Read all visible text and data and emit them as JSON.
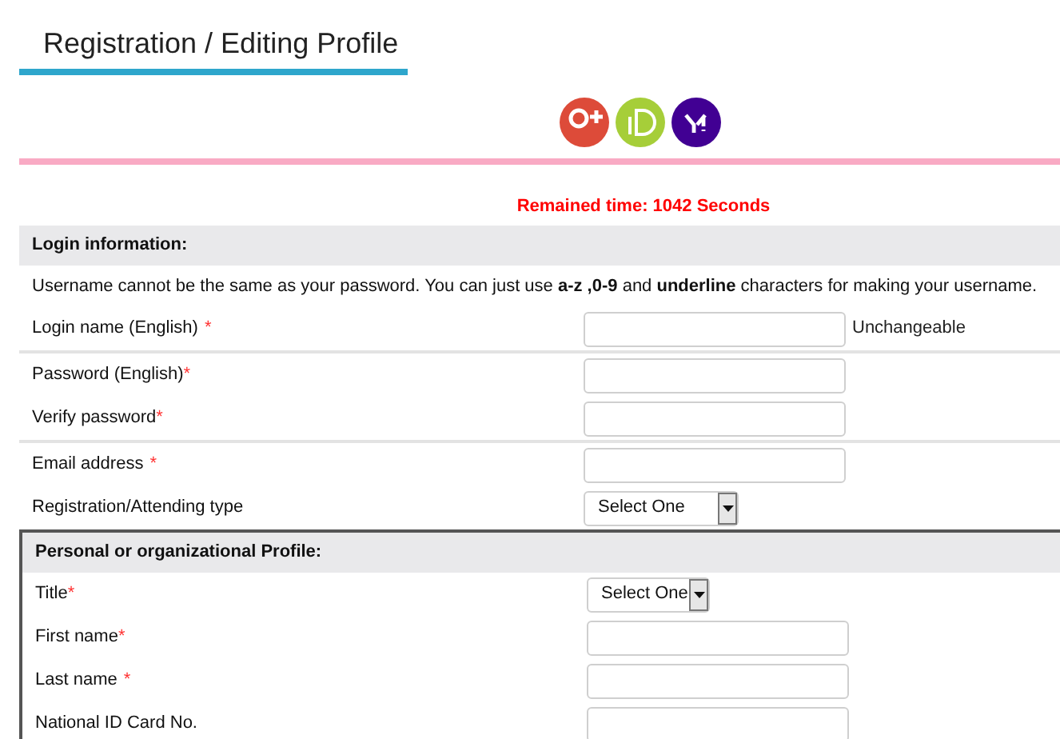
{
  "page_title": "Registration / Editing Profile",
  "timer": "Remained time: 1042 Seconds",
  "sections": [
    {
      "heading": "Login information:",
      "note": "Username cannot be the same as your password. You can just use **a-z ,0-9** and **underline** characters for making your username.",
      "top_border": false,
      "groups": [
        [
          {
            "label": "Login name (English)",
            "mark": "*",
            "spaced": true,
            "kind": "input",
            "hint": "Unchangeable"
          }
        ],
        [
          {
            "label": "Password (English)",
            "mark": "*",
            "spaced": false,
            "kind": "input"
          },
          {
            "label": "Verify password",
            "mark": "*",
            "spaced": false,
            "kind": "input"
          }
        ],
        [
          {
            "label": "Email address",
            "mark": "*",
            "spaced": true,
            "kind": "input"
          },
          {
            "label": "Registration/Attending type",
            "kind": "select",
            "value": "Select One",
            "wide": true
          }
        ]
      ]
    },
    {
      "heading": "Personal or organizational Profile:",
      "top_border": true,
      "groups": [
        [
          {
            "label": "Title",
            "mark": "*",
            "spaced": false,
            "kind": "select",
            "value": "Select One",
            "wide": false
          },
          {
            "label": "First name",
            "mark": "*",
            "spaced": false,
            "kind": "input"
          },
          {
            "label": "Last name",
            "mark": "*",
            "spaced": true,
            "kind": "input"
          },
          {
            "label": "National ID Card No.",
            "kind": "input"
          }
        ]
      ]
    }
  ]
}
